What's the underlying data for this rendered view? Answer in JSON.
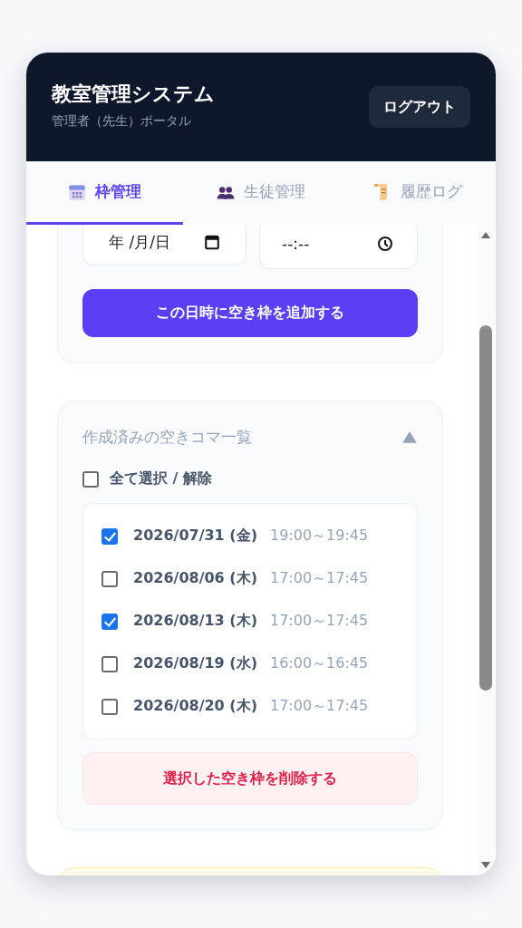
{
  "header": {
    "title": "教室管理システム",
    "subtitle": "管理者（先生）ポータル",
    "logout_button": "ログアウト"
  },
  "tabs": [
    {
      "label": "枠管理",
      "selected": true
    },
    {
      "label": "生徒管理",
      "selected": false
    },
    {
      "label": "履歴ログ",
      "selected": false
    }
  ],
  "add_slot_form": {
    "date_field": {
      "placeholder": "年 /月/日"
    },
    "time_field": {
      "placeholder": "--:--"
    },
    "add_button": "この日時に空き枠を追加する"
  },
  "slot_list": {
    "title": "作成済みの空きコマ一覧",
    "expanded": true,
    "select_all": {
      "label": "全て選択 / 解除",
      "checked": false
    },
    "slots": [
      {
        "date": "2026/07/31 (金)",
        "time": "19:00～19:45",
        "checked": true
      },
      {
        "date": "2026/08/06 (木)",
        "time": "17:00～17:45",
        "checked": false
      },
      {
        "date": "2026/08/13 (木)",
        "time": "17:00～17:45",
        "checked": true
      },
      {
        "date": "2026/08/19 (水)",
        "time": "16:00～16:45",
        "checked": false
      },
      {
        "date": "2026/08/20 (木)",
        "time": "17:00～17:45",
        "checked": false
      }
    ],
    "delete_button": "選択した空き枠を削除する"
  }
}
